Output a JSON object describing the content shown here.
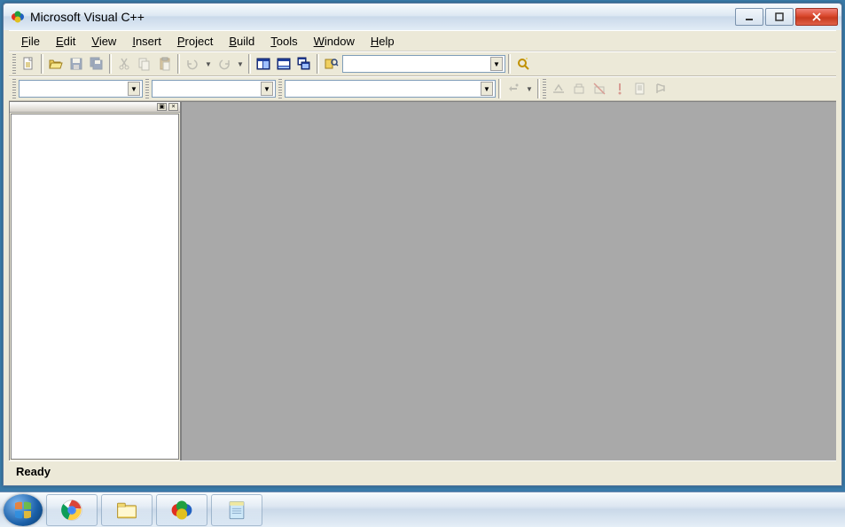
{
  "window": {
    "title": "Microsoft Visual C++"
  },
  "menu": {
    "file": "File",
    "edit": "Edit",
    "view": "View",
    "insert": "Insert",
    "project": "Project",
    "build": "Build",
    "tools": "Tools",
    "window": "Window",
    "help": "Help"
  },
  "toolbar": {
    "find_combo": ""
  },
  "toolbar2": {
    "class_combo": "",
    "filter_combo": "",
    "member_combo": ""
  },
  "statusbar": {
    "text": "Ready"
  },
  "icons": {
    "new": "new-file",
    "open": "open",
    "save": "save",
    "saveall": "save-all",
    "cut": "cut",
    "copy": "copy",
    "paste": "paste",
    "undo": "undo",
    "redo": "redo",
    "window1": "workspace",
    "window2": "output",
    "windowlist": "window-list",
    "tile": "find-in-files",
    "find": "find",
    "wizard": "wizard-bar"
  }
}
